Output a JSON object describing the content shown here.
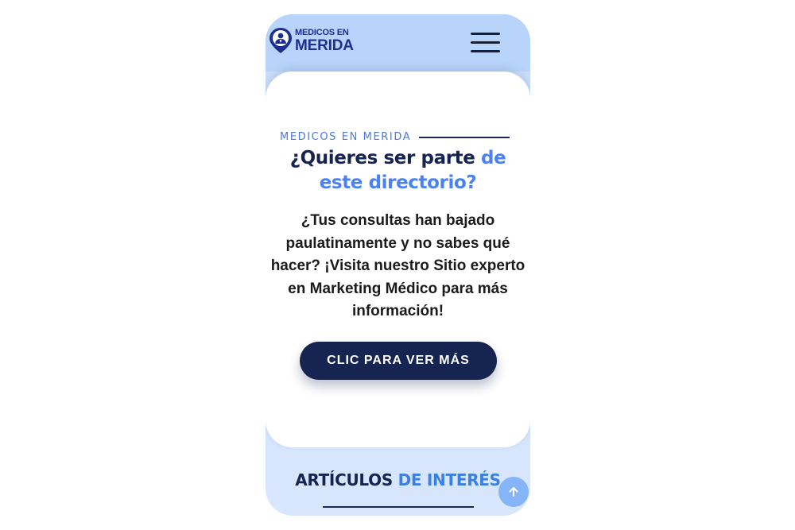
{
  "header": {
    "logo_line1": "MEDICOS EN",
    "logo_line2": "MERIDA",
    "menu_icon": "hamburger-menu-icon"
  },
  "hero": {
    "eyebrow": "MEDICOS EN MERIDA",
    "headline_part1": "¿Quieres ser parte ",
    "headline_accent1": "de",
    "headline_accent2": "este directorio?",
    "body_line1": "¿Tus consultas han bajado",
    "body_line2": "paulatinamente y no sabes qué",
    "body_line3": "hacer? ¡Visita nuestro Sitio experto",
    "body_line4": "en Marketing Médico para más",
    "body_line5": "información!",
    "cta_label": "CLIC PARA VER MÁS"
  },
  "articles": {
    "title_part1": "ARTÍCULOS ",
    "title_accent": "DE INTERÉS"
  },
  "scroll_top_icon": "arrow-up-icon",
  "colors": {
    "header_bg": "#b8d4fa",
    "navy": "#152451",
    "accent_blue": "#4a82f2",
    "eyebrow_blue": "#4c7ad8",
    "scroll_btn": "#85b4f7"
  }
}
